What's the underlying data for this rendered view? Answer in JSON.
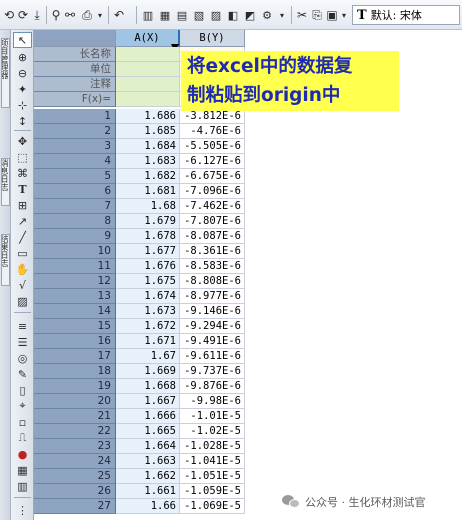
{
  "toolbar": {
    "font_label": "默认: 宋体",
    "icons": [
      "undo-icon",
      "redo-icon",
      "import-icon",
      "zoom-icon",
      "print-icon",
      "undo-dropdown-icon",
      "column-add-icon",
      "statistics-icon",
      "merge-icon",
      "calculate-icon",
      "plot-icon",
      "chart-icon",
      "sort-icon",
      "text-bold-icon",
      "text-italic-icon"
    ]
  },
  "sidebar_tabs": [
    "项目管理器",
    "消息日志",
    "结果日志"
  ],
  "tools": [
    "pointer-icon",
    "zoom-in-icon",
    "zoom-out-icon",
    "scale-icon",
    "screen-reader-icon",
    "data-reader-icon",
    "move-icon",
    "region-icon",
    "text-icon",
    "arrow-icon",
    "line-icon",
    "rect-icon",
    "hand-icon",
    "formula-icon",
    "graph-icon",
    "table-icon",
    "mask-icon",
    "annotate-icon",
    "layer-icon",
    "draw-icon",
    "frame-icon",
    "pin-icon",
    "erase-icon",
    "grid-icon",
    "column-icon",
    "plot-sep-icon"
  ],
  "sheet": {
    "columns": [
      {
        "header": "A(X)"
      },
      {
        "header": "B(Y)"
      }
    ],
    "meta_rows": [
      "长名称",
      "单位",
      "注释",
      "F(x)="
    ],
    "rows": [
      {
        "n": "1",
        "a": "1.686",
        "b": "-3.812E-6"
      },
      {
        "n": "2",
        "a": "1.685",
        "b": "-4.76E-6"
      },
      {
        "n": "3",
        "a": "1.684",
        "b": "-5.505E-6"
      },
      {
        "n": "4",
        "a": "1.683",
        "b": "-6.127E-6"
      },
      {
        "n": "5",
        "a": "1.682",
        "b": "-6.675E-6"
      },
      {
        "n": "6",
        "a": "1.681",
        "b": "-7.096E-6"
      },
      {
        "n": "7",
        "a": "1.68",
        "b": "-7.462E-6"
      },
      {
        "n": "8",
        "a": "1.679",
        "b": "-7.807E-6"
      },
      {
        "n": "9",
        "a": "1.678",
        "b": "-8.087E-6"
      },
      {
        "n": "10",
        "a": "1.677",
        "b": "-8.361E-6"
      },
      {
        "n": "11",
        "a": "1.676",
        "b": "-8.583E-6"
      },
      {
        "n": "12",
        "a": "1.675",
        "b": "-8.808E-6"
      },
      {
        "n": "13",
        "a": "1.674",
        "b": "-8.977E-6"
      },
      {
        "n": "14",
        "a": "1.673",
        "b": "-9.146E-6"
      },
      {
        "n": "15",
        "a": "1.672",
        "b": "-9.294E-6"
      },
      {
        "n": "16",
        "a": "1.671",
        "b": "-9.491E-6"
      },
      {
        "n": "17",
        "a": "1.67",
        "b": "-9.611E-6"
      },
      {
        "n": "18",
        "a": "1.669",
        "b": "-9.737E-6"
      },
      {
        "n": "19",
        "a": "1.668",
        "b": "-9.876E-6"
      },
      {
        "n": "20",
        "a": "1.667",
        "b": "-9.98E-6"
      },
      {
        "n": "21",
        "a": "1.666",
        "b": "-1.01E-5"
      },
      {
        "n": "22",
        "a": "1.665",
        "b": "-1.02E-5"
      },
      {
        "n": "23",
        "a": "1.664",
        "b": "-1.028E-5"
      },
      {
        "n": "24",
        "a": "1.663",
        "b": "-1.041E-5"
      },
      {
        "n": "25",
        "a": "1.662",
        "b": "-1.051E-5"
      },
      {
        "n": "26",
        "a": "1.661",
        "b": "-1.059E-5"
      },
      {
        "n": "27",
        "a": "1.66",
        "b": "-1.069E-5"
      }
    ]
  },
  "annotation": {
    "line1": "将excel中的数据复",
    "line2": "制粘贴到origin中"
  },
  "watermark": {
    "text": "公众号 · 生化环材测试官"
  }
}
